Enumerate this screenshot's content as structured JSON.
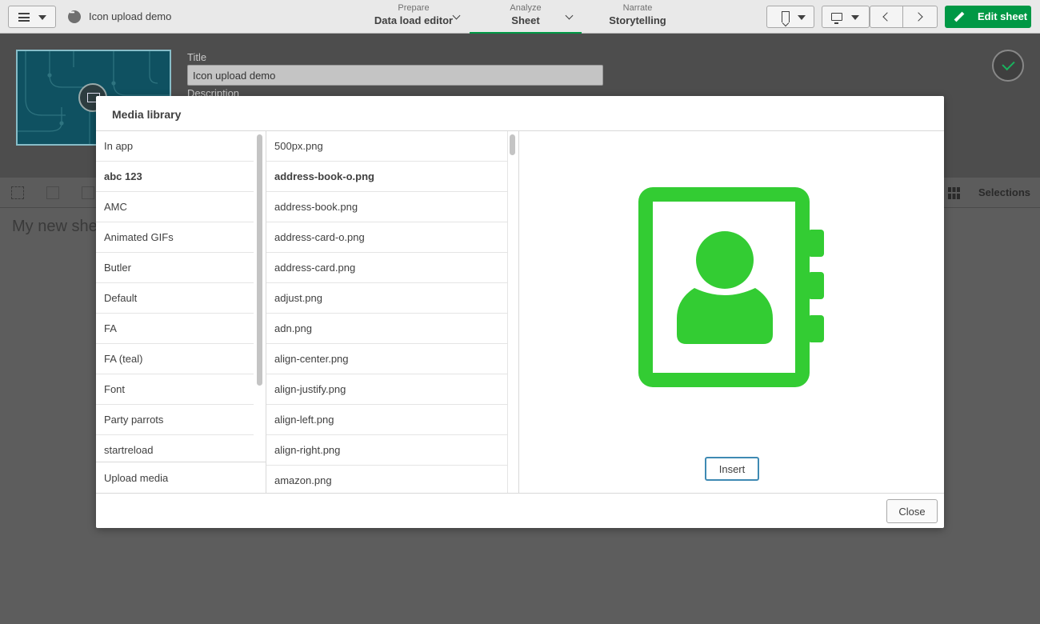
{
  "app": {
    "title": "Icon upload demo"
  },
  "nav": {
    "prepare": {
      "sub": "Prepare",
      "main": "Data load editor"
    },
    "analyze": {
      "sub": "Analyze",
      "main": "Sheet"
    },
    "narrate": {
      "sub": "Narrate",
      "main": "Storytelling"
    }
  },
  "toolbar": {
    "edit_label": "Edit sheet",
    "accent": "#009845"
  },
  "properties": {
    "title_label": "Title",
    "title_value": "Icon upload demo",
    "description_label": "Description"
  },
  "sheet": {
    "title": "My new she",
    "selections_label": "Selections"
  },
  "modal": {
    "title": "Media library",
    "folders": [
      {
        "label": "In app"
      },
      {
        "label": "abc 123"
      },
      {
        "label": "AMC"
      },
      {
        "label": "Animated GIFs"
      },
      {
        "label": "Butler"
      },
      {
        "label": "Default"
      },
      {
        "label": "FA"
      },
      {
        "label": "FA (teal)"
      },
      {
        "label": "Font"
      },
      {
        "label": "Party parrots"
      },
      {
        "label": "startreload"
      }
    ],
    "selected_folder": "abc 123",
    "upload_label": "Upload media",
    "files": [
      {
        "label": "500px.png"
      },
      {
        "label": "address-book-o.png"
      },
      {
        "label": "address-book.png"
      },
      {
        "label": "address-card-o.png"
      },
      {
        "label": "address-card.png"
      },
      {
        "label": "adjust.png"
      },
      {
        "label": "adn.png"
      },
      {
        "label": "align-center.png"
      },
      {
        "label": "align-justify.png"
      },
      {
        "label": "align-left.png"
      },
      {
        "label": "align-right.png"
      },
      {
        "label": "amazon.png"
      }
    ],
    "selected_file": "address-book-o.png",
    "preview_icon": "address-book-icon",
    "preview_color": "#33cc33",
    "insert_label": "Insert",
    "close_label": "Close"
  }
}
